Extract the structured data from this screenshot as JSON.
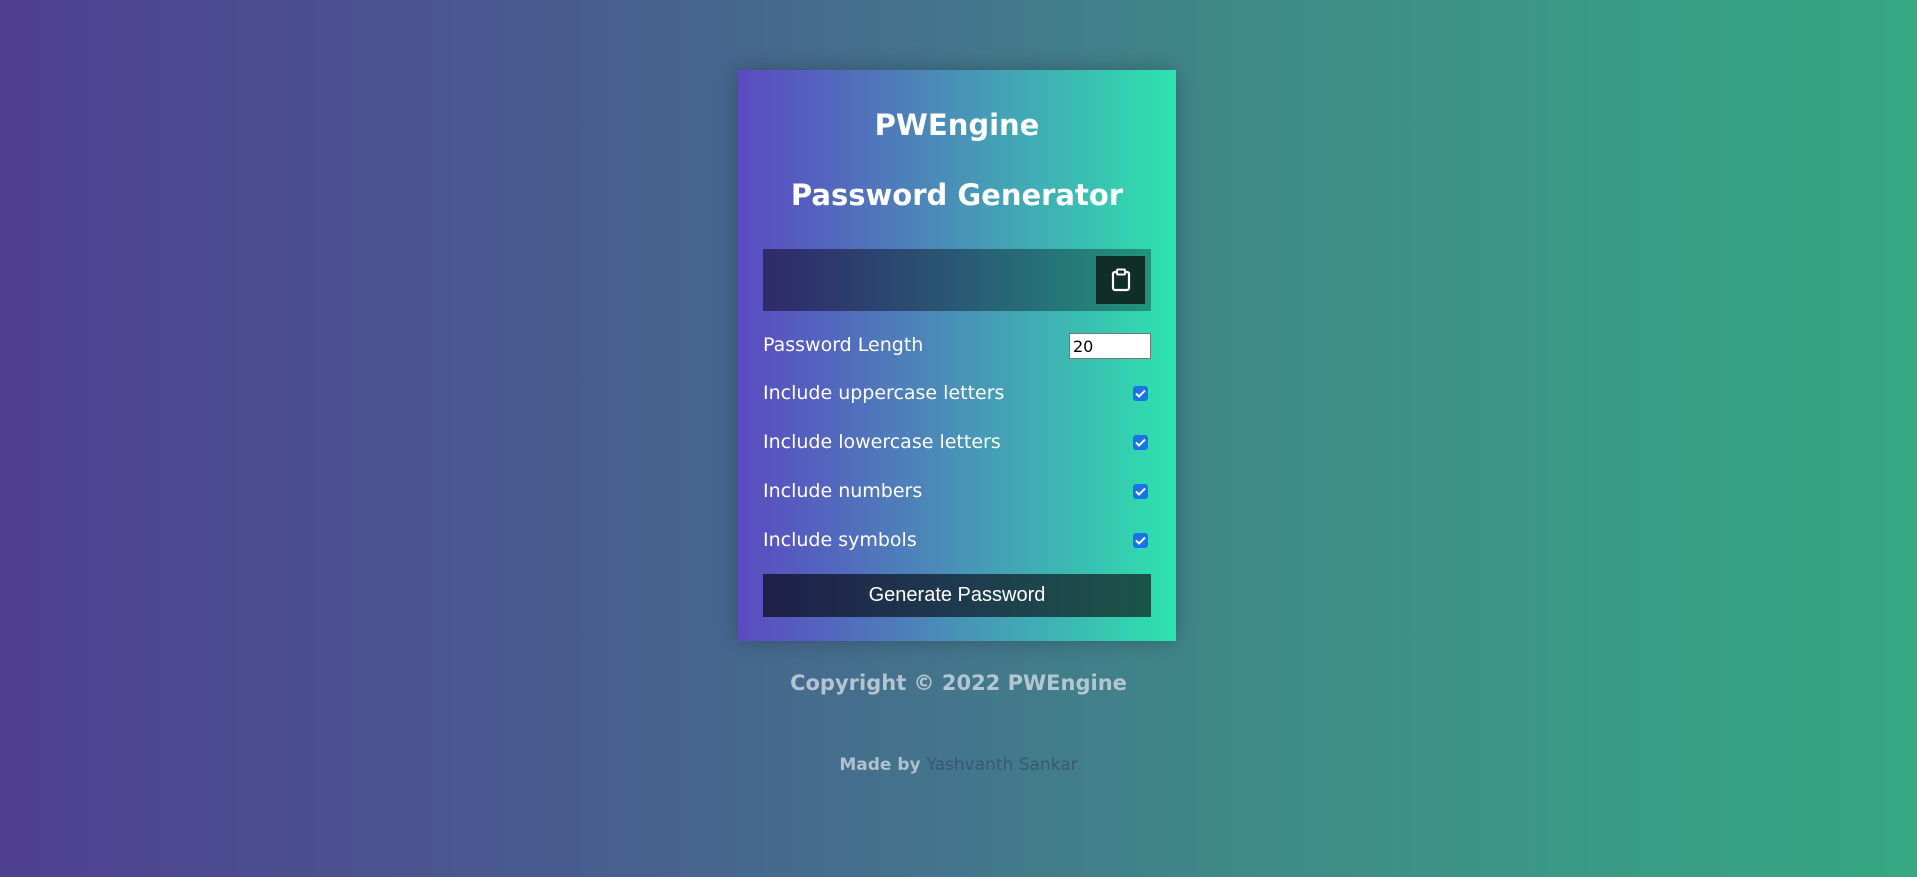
{
  "app": {
    "title": "PWEngine",
    "subtitle": "Password Generator"
  },
  "result": {
    "value": "",
    "copy_icon": "clipboard-icon"
  },
  "settings": {
    "length_label": "Password Length",
    "length_value": "20",
    "uppercase_label": "Include uppercase letters",
    "uppercase_checked": true,
    "lowercase_label": "Include lowercase letters",
    "lowercase_checked": true,
    "numbers_label": "Include numbers",
    "numbers_checked": true,
    "symbols_label": "Include symbols",
    "symbols_checked": true
  },
  "actions": {
    "generate_label": "Generate Password"
  },
  "footer": {
    "copyright": "Copyright © 2022 PWEngine",
    "made_by_prefix": "Made by",
    "author": "Yashvanth Sankar"
  },
  "colors": {
    "checkbox_accent": "#1a73e8",
    "copy_button_bg": "#0f2e28"
  }
}
